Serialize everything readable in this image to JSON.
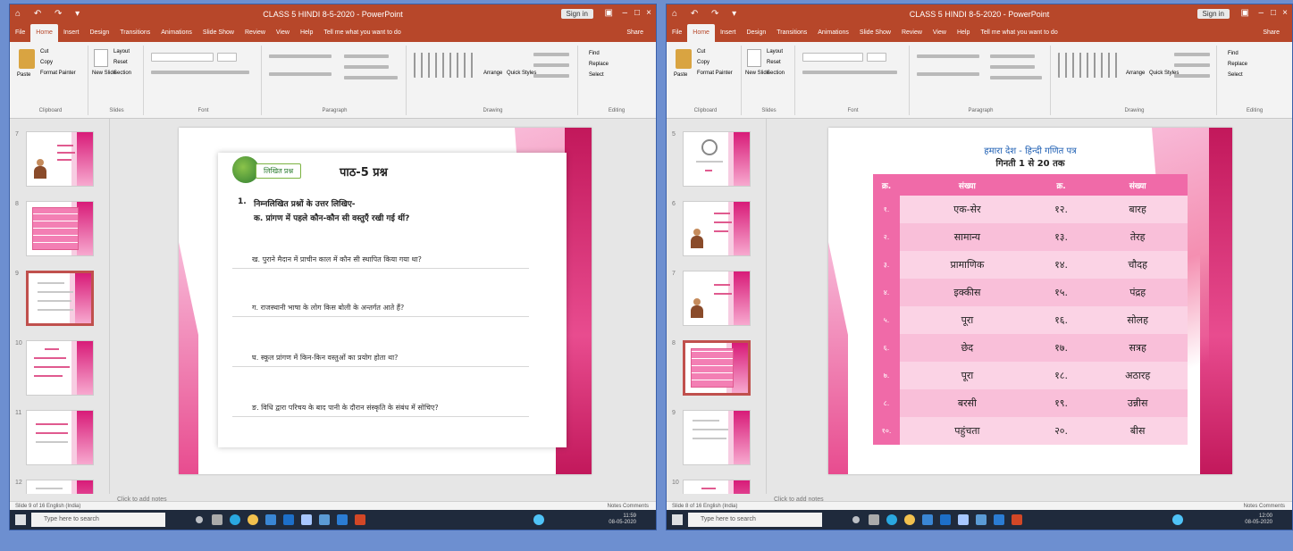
{
  "taskbar": {
    "search_placeholder": "Type here to search"
  },
  "left_window": {
    "title": "CLASS 5 HINDI 8-5-2020 - PowerPoint",
    "sign_in": "Sign in",
    "share": "Share",
    "tabs": [
      "File",
      "Home",
      "Insert",
      "Design",
      "Transitions",
      "Animations",
      "Slide Show",
      "Review",
      "View",
      "Help",
      "Tell me what you want to do"
    ],
    "ribbon_groups": [
      "Clipboard",
      "Slides",
      "Font",
      "Paragraph",
      "Drawing",
      "Editing"
    ],
    "clipboard": {
      "paste": "Paste",
      "cut": "Cut",
      "copy": "Copy",
      "format_painter": "Format Painter"
    },
    "slides_group": {
      "new_slide": "New Slide",
      "layout": "Layout",
      "reset": "Reset",
      "section": "Section"
    },
    "editing": {
      "find": "Find",
      "replace": "Replace",
      "select": "Select"
    },
    "drawing": {
      "arrange": "Arrange",
      "quick_styles": "Quick Styles"
    },
    "thumb_numbers": [
      "7",
      "8",
      "9",
      "10",
      "11",
      "12"
    ],
    "slide": {
      "title": "पाठ-5 प्रश्न",
      "badge": "लिखित प्रश्न",
      "q_number": "1.",
      "q_main": "निम्नलिखित प्रश्नों के उत्तर लिखिए-",
      "q_sub": "क. प्रांगण में पहले कौन-कौन सी वस्तुएँ रखी गई थीं?",
      "lines": [
        "ख. पुराने मैदान में प्राचीन काल में कौन सी स्थापित किया गया था?",
        "ग. राजस्थानी भाषा के लोग किस बोली के अन्तर्गत आते हैं?",
        "घ. स्कूल प्रांगण में किन-किन वस्तुओं का प्रयोग होता था?",
        "ङ. विधि द्वारा परिचय के बाद पानी के दौरान संस्कृति के संबंध में सोचिए?"
      ]
    },
    "notes": "Click to add notes",
    "status": "Slide 9 of 16    English (India)",
    "status_right": "Notes    Comments",
    "clock": [
      "11:59",
      "08-05-2020"
    ]
  },
  "right_window": {
    "title": "CLASS 5 HINDI 8-5-2020 - PowerPoint",
    "sign_in": "Sign in",
    "share": "Share",
    "tabs": [
      "File",
      "Home",
      "Insert",
      "Design",
      "Transitions",
      "Animations",
      "Slide Show",
      "Review",
      "View",
      "Help",
      "Tell me what you want to do"
    ],
    "ribbon_groups": [
      "Clipboard",
      "Slides",
      "Font",
      "Paragraph",
      "Drawing",
      "Editing"
    ],
    "clipboard": {
      "paste": "Paste",
      "cut": "Cut",
      "copy": "Copy",
      "format_painter": "Format Painter"
    },
    "slides_group": {
      "new_slide": "New Slide",
      "layout": "Layout",
      "reset": "Reset",
      "section": "Section"
    },
    "editing": {
      "find": "Find",
      "replace": "Replace",
      "select": "Select"
    },
    "drawing": {
      "arrange": "Arrange",
      "quick_styles": "Quick Styles"
    },
    "thumb_numbers": [
      "5",
      "6",
      "7",
      "8",
      "9",
      "10"
    ],
    "slide": {
      "title_line1": "हमारा देश - हिन्दी गणित पत्र",
      "title_line2": "गिनती 1 से 20 तक",
      "header": [
        "क्र.",
        "संख्या",
        "क्र.",
        "संख्या"
      ],
      "rows": [
        [
          "१.",
          "एक-सेर",
          "१२.",
          "बारह"
        ],
        [
          "२.",
          "सामान्य",
          "१३.",
          "तेरह"
        ],
        [
          "३.",
          "प्रामाणिक",
          "१४.",
          "चौदह"
        ],
        [
          "४.",
          "इक्कीस",
          "१५.",
          "पंद्रह"
        ],
        [
          "५.",
          "पूरा",
          "१६.",
          "सोलह"
        ],
        [
          "६.",
          "छेद",
          "१७.",
          "सत्रह"
        ],
        [
          "७.",
          "पूरा",
          "१८.",
          "अठारह"
        ],
        [
          "८.",
          "बरसी",
          "१९.",
          "उन्नीस"
        ],
        [
          "१०.",
          "पहुंचता",
          "२०.",
          "बीस"
        ]
      ]
    },
    "notes": "Click to add notes",
    "status": "Slide 8 of 16    English (India)",
    "status_right": "Notes    Comments",
    "clock": [
      "12:00",
      "08-05-2020"
    ]
  }
}
